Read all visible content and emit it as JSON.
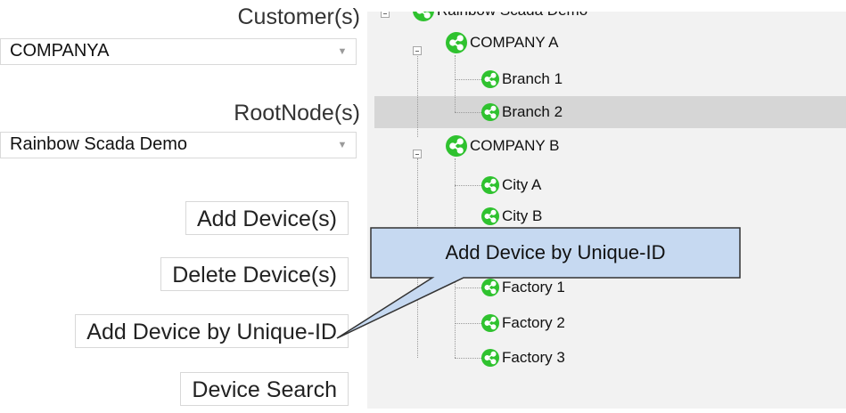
{
  "left_panel": {
    "customer_label": "Customer(s)",
    "customer_value": "COMPANYA",
    "rootnode_label": "RootNode(s)",
    "rootnode_value": "Rainbow Scada Demo",
    "buttons": {
      "add_device": "Add Device(s)",
      "delete_device": "Delete Device(s)",
      "add_by_unique_id": "Add Device by Unique-ID",
      "device_search": "Device Search"
    }
  },
  "tree": {
    "root": "Rainbow Scada Demo",
    "nodes": [
      {
        "label": "COMPANY A"
      },
      {
        "label": "Branch 1"
      },
      {
        "label": "Branch 2",
        "selected": true
      },
      {
        "label": "COMPANY B"
      },
      {
        "label": "City A"
      },
      {
        "label": "City B"
      },
      {
        "label": "Factory 1"
      },
      {
        "label": "Factory 2"
      },
      {
        "label": "Factory 3"
      }
    ]
  },
  "callout": {
    "text": "Add Device by Unique-ID"
  },
  "colors": {
    "node_icon": "#2fc22f",
    "tree_background": "#f2f2f2",
    "selected_row": "#d6d6d6",
    "callout_fill": "#c6d9f1",
    "callout_border": "#333333"
  },
  "icons": {
    "node": "share-icon",
    "select_arrow": "triangle-down-icon",
    "expander": "collapse-minus-icon"
  }
}
